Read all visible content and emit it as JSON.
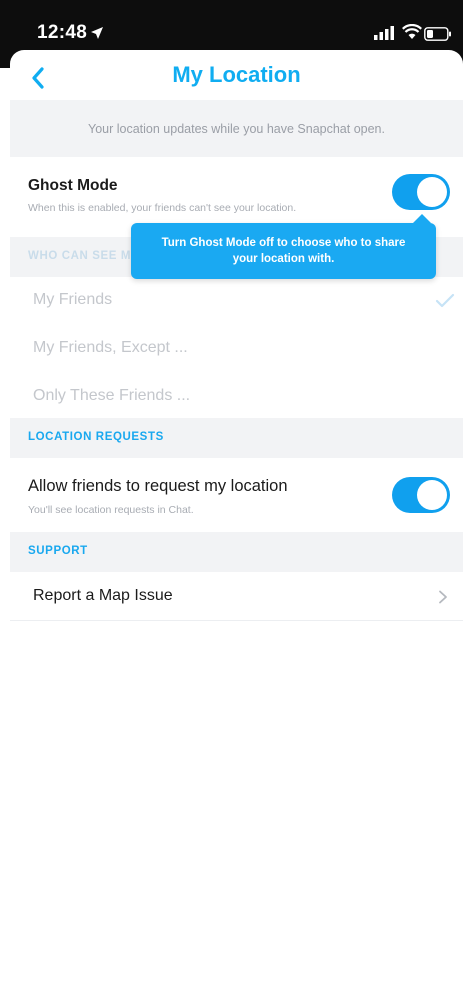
{
  "status_bar": {
    "time": "12:48",
    "icons": [
      "location-arrow-icon",
      "signal-icon",
      "wifi-icon",
      "battery-icon"
    ]
  },
  "nav": {
    "title": "My Location",
    "back_icon": "chevron-left-icon"
  },
  "banner": {
    "text": "Your location updates while you have Snapchat open."
  },
  "ghost_mode": {
    "title": "Ghost Mode",
    "subtitle": "When this is enabled, your friends can't see your location.",
    "enabled": true
  },
  "tooltip": {
    "line1": "Turn Ghost Mode off to choose who to share",
    "line2": "your location with."
  },
  "who_can_see": {
    "header": "WHO CAN SEE MY LOCATION",
    "options": [
      {
        "label": "My Friends",
        "selected": true
      },
      {
        "label": "My Friends, Except ..."
      },
      {
        "label": "Only These Friends ..."
      }
    ]
  },
  "location_requests": {
    "header": "LOCATION REQUESTS",
    "title": "Allow friends to request my location",
    "subtitle": "You'll see location requests in Chat.",
    "enabled": true
  },
  "support": {
    "header": "SUPPORT",
    "item": "Report a Map Issue"
  },
  "colors": {
    "accent": "#10a0ee",
    "title_blue": "#10adf1",
    "section_bg": "#f2f3f5",
    "status_bg": "#0d0d0d"
  }
}
